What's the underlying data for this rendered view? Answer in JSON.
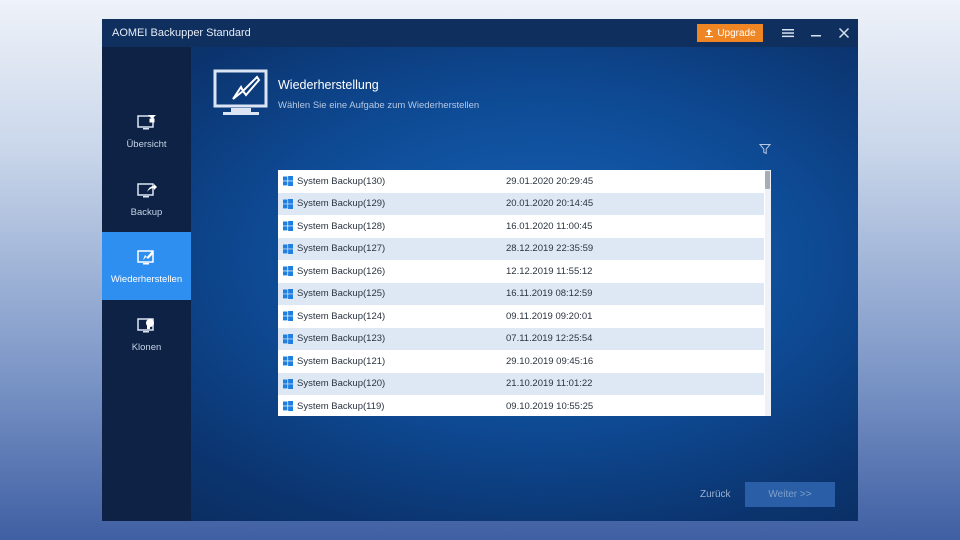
{
  "window": {
    "title": "AOMEI Backupper Standard"
  },
  "titlebar": {
    "upgrade_label": "Upgrade",
    "upgrade_color": "#f08523"
  },
  "sidebar": {
    "items": [
      {
        "label": "Übersicht",
        "icon": "monitor-home-icon"
      },
      {
        "label": "Backup",
        "icon": "monitor-share-icon"
      },
      {
        "label": "Wiederherstellen",
        "icon": "monitor-restore-icon",
        "active": true
      },
      {
        "label": "Klonen",
        "icon": "monitor-clone-icon"
      }
    ]
  },
  "main": {
    "title": "Wiederherstellung",
    "subtitle": "Wählen Sie eine Aufgabe zum Wiederherstellen"
  },
  "tasks": [
    {
      "name": "System Backup(130)",
      "date": "29.01.2020 20:29:45"
    },
    {
      "name": "System Backup(129)",
      "date": "20.01.2020 20:14:45"
    },
    {
      "name": "System Backup(128)",
      "date": "16.01.2020 11:00:45"
    },
    {
      "name": "System Backup(127)",
      "date": "28.12.2019 22:35:59"
    },
    {
      "name": "System Backup(126)",
      "date": "12.12.2019 11:55:12"
    },
    {
      "name": "System Backup(125)",
      "date": "16.11.2019 08:12:59"
    },
    {
      "name": "System Backup(124)",
      "date": "09.11.2019 09:20:01"
    },
    {
      "name": "System Backup(123)",
      "date": "07.11.2019 12:25:54"
    },
    {
      "name": "System Backup(121)",
      "date": "29.10.2019 09:45:16"
    },
    {
      "name": "System Backup(120)",
      "date": "21.10.2019 11:01:22"
    },
    {
      "name": "System Backup(119)",
      "date": "09.10.2019 10:55:25"
    }
  ],
  "footer": {
    "back_label": "Zurück",
    "next_label": "Weiter >>"
  },
  "colors": {
    "accent": "#2f8ff1",
    "upgrade": "#f08523",
    "titlebar": "#0f2f5e",
    "sidebar": "#0d2244"
  }
}
